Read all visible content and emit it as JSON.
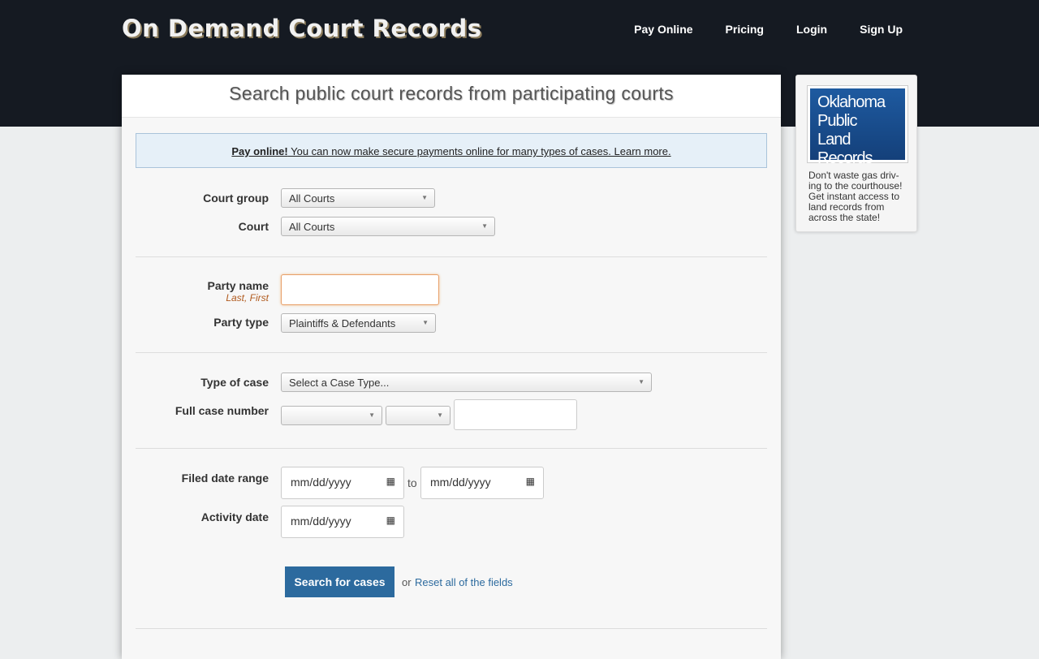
{
  "header": {
    "logo": "On Demand Court Records",
    "nav": [
      "Pay Online",
      "Pricing",
      "Login",
      "Sign Up"
    ]
  },
  "main": {
    "title": "Search public court records from participating courts",
    "notice": {
      "bold": "Pay online!",
      "text": " You can now make secure payments online for many types of cases. Learn more."
    },
    "court_group": {
      "label": "Court group",
      "value": "All Courts"
    },
    "court": {
      "label": "Court",
      "value": "All Courts"
    },
    "party_name": {
      "label": "Party name",
      "hint": "Last, First",
      "value": ""
    },
    "party_type": {
      "label": "Party type",
      "value": "Plaintiffs & Defendants"
    },
    "case_type": {
      "label": "Type of case",
      "value": "Select a Case Type..."
    },
    "case_number": {
      "label": "Full case number",
      "sel1": "",
      "sel2": "",
      "value": ""
    },
    "filed_date": {
      "label": "Filed date range",
      "from": "mm/dd/yyyy",
      "to_label": "to",
      "to": "mm/dd/yyyy"
    },
    "activity_date": {
      "label": "Activity date",
      "value": "mm/dd/yyyy"
    },
    "search_button": "Search for cases",
    "or": "or",
    "reset_link": "Reset all of the fields"
  },
  "sidebar": {
    "ad_lines": [
      "Oklahoma",
      "Public",
      "Land Records"
    ],
    "text": "Don't waste gas driv-ing to the courthouse! Get instant access to land records from across the state!"
  },
  "colors": {
    "accent": "#2c6a9e",
    "header_bg": "#151a22",
    "focus_border": "#e8a06a"
  }
}
